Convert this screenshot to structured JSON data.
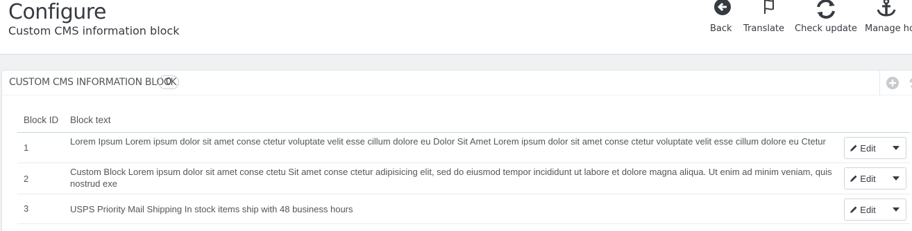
{
  "header": {
    "title": "Configure",
    "subtitle": "Custom CMS information block",
    "toolbar": [
      {
        "label": "Back",
        "icon": "back-arrow-icon"
      },
      {
        "label": "Translate",
        "icon": "flag-icon"
      },
      {
        "label": "Check update",
        "icon": "refresh-icon"
      },
      {
        "label": "Manage ho",
        "icon": "anchor-icon"
      }
    ]
  },
  "panel": {
    "title": "CUSTOM CMS INFORMATION BLOCK",
    "count": "0",
    "columns": [
      "Block ID",
      "Block text"
    ],
    "rows": [
      {
        "id": "1",
        "text": "Lorem Ipsum Lorem ipsum dolor sit amet conse ctetur voluptate velit esse cillum dolore eu Dolor Sit Amet Lorem ipsum dolor sit amet conse ctetur voluptate velit esse cillum dolore eu Ctetur",
        "action": "Edit"
      },
      {
        "id": "2",
        "text": "Custom Block Lorem ipsum dolor sit amet conse ctetu Sit amet conse ctetur adipisicing elit, sed do eiusmod tempor incididunt ut labore et dolore magna aliqua. Ut enim ad minim veniam, quis nostrud exe",
        "action": "Edit"
      },
      {
        "id": "3",
        "text": "USPS Priority Mail Shipping In stock items ship with 48 business hours",
        "action": "Edit"
      }
    ]
  },
  "colors": {
    "text": "#555555",
    "heading": "#363a41",
    "border": "#e1e4e6",
    "background": "#eff1f2"
  }
}
